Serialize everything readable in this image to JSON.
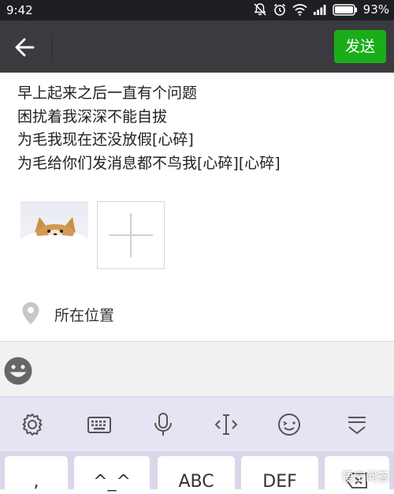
{
  "status_bar": {
    "time": "9:42",
    "battery_percent": "93%"
  },
  "header": {
    "send_label": "发送"
  },
  "post": {
    "lines": [
      "早上起来之后一直有个问题",
      "困扰着我深深不能自拔",
      "为毛我现在还没放假[心碎]",
      "为毛给你们发消息都不鸟我[心碎][心碎]"
    ]
  },
  "location": {
    "label": "所在位置"
  },
  "keyboard": {
    "keys": [
      ",",
      "^_^",
      "ABC",
      "DEF"
    ]
  },
  "watermark": {
    "text": "悟空问答"
  },
  "colors": {
    "accent": "#1aad19",
    "header_bg": "#3a3a3f",
    "status_bg": "#1e1f23"
  }
}
